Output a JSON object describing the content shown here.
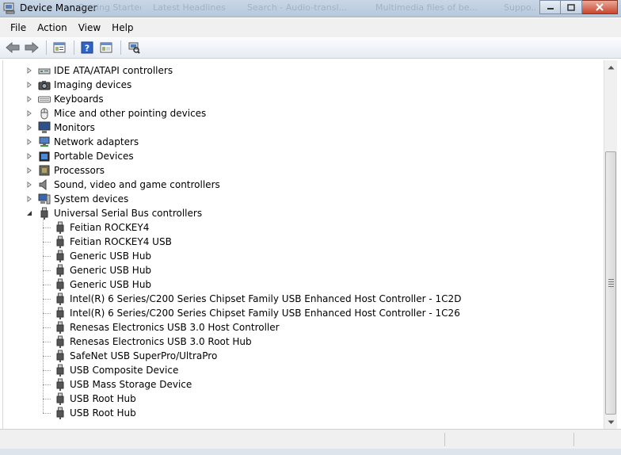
{
  "window": {
    "title": "Device Manager",
    "background_tabs": [
      "Getting Started",
      "Latest Headlines",
      "Search - Audio-transl...",
      "Multimedia files of be...",
      "Suppo..."
    ]
  },
  "menu": [
    "File",
    "Action",
    "View",
    "Help"
  ],
  "toolbar": {
    "buttons": [
      "back-icon",
      "forward-icon",
      "properties-list-icon",
      "help-icon",
      "details-view-icon",
      "scan-hardware-icon"
    ]
  },
  "tree": {
    "categories": [
      {
        "label": "IDE ATA/ATAPI controllers",
        "icon": "ide-controller-icon",
        "expanded": false
      },
      {
        "label": "Imaging devices",
        "icon": "camera-icon",
        "expanded": false
      },
      {
        "label": "Keyboards",
        "icon": "keyboard-icon",
        "expanded": false
      },
      {
        "label": "Mice and other pointing devices",
        "icon": "mouse-icon",
        "expanded": false
      },
      {
        "label": "Monitors",
        "icon": "monitor-icon",
        "expanded": false
      },
      {
        "label": "Network adapters",
        "icon": "network-icon",
        "expanded": false
      },
      {
        "label": "Portable Devices",
        "icon": "portable-device-icon",
        "expanded": false
      },
      {
        "label": "Processors",
        "icon": "processor-icon",
        "expanded": false
      },
      {
        "label": "Sound, video and game controllers",
        "icon": "speaker-icon",
        "expanded": false
      },
      {
        "label": "System devices",
        "icon": "computer-icon",
        "expanded": false
      },
      {
        "label": "Universal Serial Bus controllers",
        "icon": "usb-plug-icon",
        "expanded": true
      }
    ],
    "usb_children": [
      "Feitian ROCKEY4",
      "Feitian ROCKEY4 USB",
      "Generic USB Hub",
      "Generic USB Hub",
      "Generic USB Hub",
      "Intel(R) 6 Series/C200 Series Chipset Family USB Enhanced Host Controller - 1C2D",
      "Intel(R) 6 Series/C200 Series Chipset Family USB Enhanced Host Controller - 1C26",
      "Renesas Electronics USB 3.0 Host Controller",
      "Renesas Electronics USB 3.0 Root Hub",
      "SafeNet USB SuperPro/UltraPro",
      "USB Composite Device",
      "USB Mass Storage Device",
      "USB Root Hub",
      "USB Root Hub"
    ]
  },
  "colors": {
    "titlebar": "#c9d6e6",
    "menubar": "#f0f0f0",
    "close_button": "#c9462c"
  }
}
